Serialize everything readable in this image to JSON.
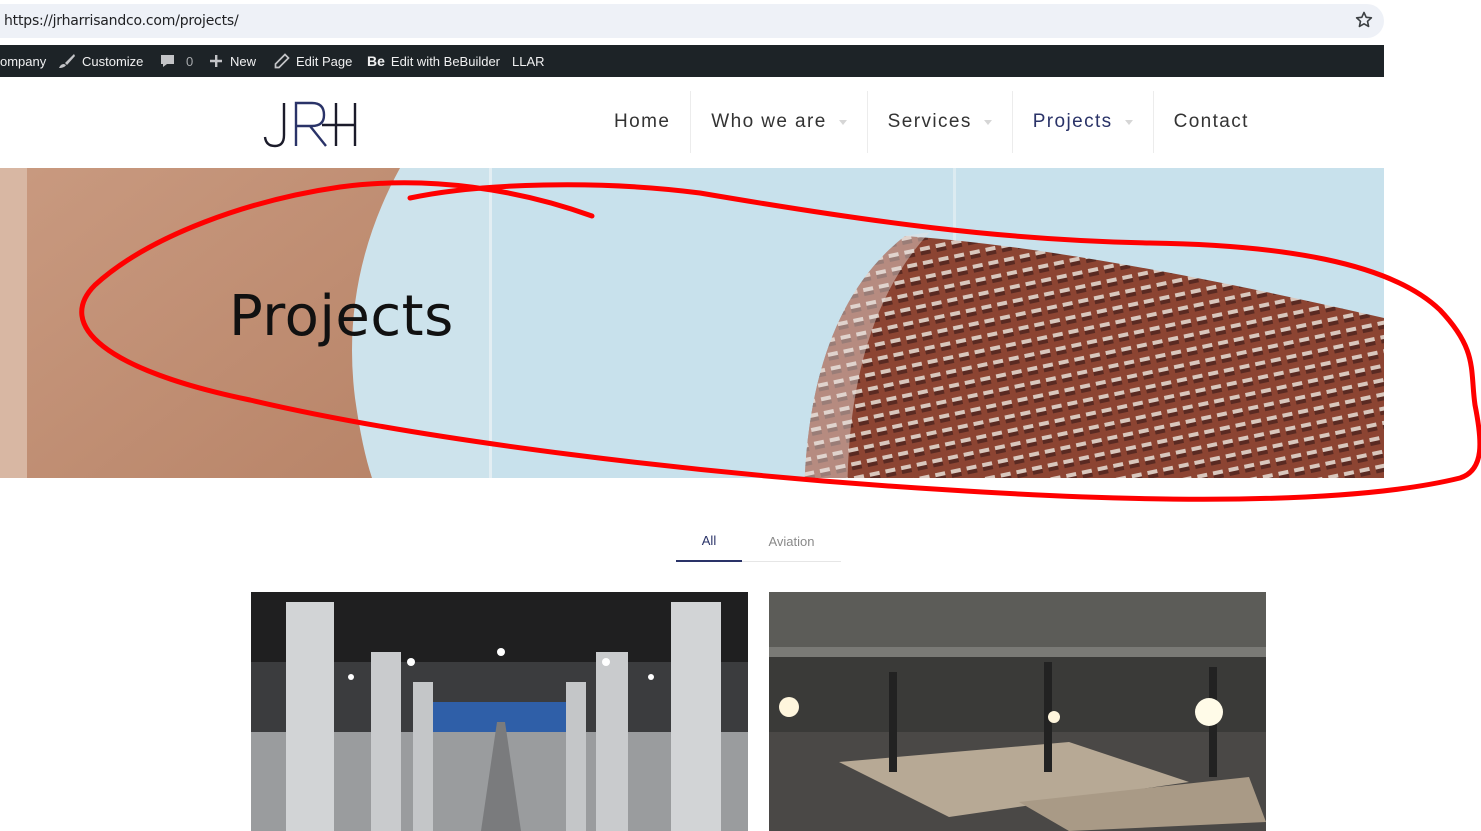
{
  "browser": {
    "url": "https://jrharrisandco.com/projects/",
    "icons": [
      "star-icon"
    ]
  },
  "admin_bar": {
    "company": "ompany",
    "customize": "Customize",
    "comments_count": "0",
    "new": "New",
    "edit_page": "Edit Page",
    "bebuilder_badge": "Be",
    "bebuilder": "Edit with BeBuilder",
    "llar": "LLAR",
    "icons": [
      "brush-icon",
      "comment-icon",
      "plus-icon",
      "pencil-icon"
    ]
  },
  "site": {
    "logo_text": "JRH",
    "nav": [
      {
        "label": "Home",
        "dropdown": false,
        "active": false
      },
      {
        "label": "Who we are",
        "dropdown": true,
        "active": false
      },
      {
        "label": "Services",
        "dropdown": true,
        "active": false
      },
      {
        "label": "Projects",
        "dropdown": true,
        "active": true
      },
      {
        "label": "Contact",
        "dropdown": false,
        "active": false
      }
    ]
  },
  "hero": {
    "title": "Projects"
  },
  "filters": {
    "all": "All",
    "aviation": "Aviation"
  },
  "colors": {
    "accent": "#2a3368",
    "admin_bar": "#1d2327",
    "annotation": "#ff0000",
    "sky": "#c8e1ec",
    "brick": "#9a4a38"
  }
}
